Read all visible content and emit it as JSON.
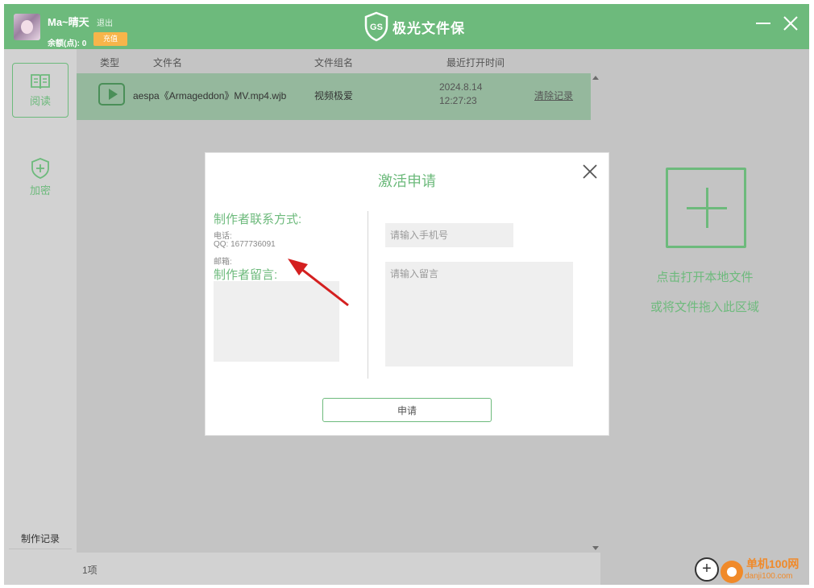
{
  "header": {
    "username": "Ma~晴天",
    "logout_label": "退出",
    "balance": "余额(点): 0",
    "recharge_label": "充值",
    "brand_badge": "GS",
    "brand_name": "极光文件保"
  },
  "sidebar": {
    "items": [
      {
        "label": "阅读",
        "icon": "book-icon"
      },
      {
        "label": "加密",
        "icon": "shield-plus-icon"
      }
    ],
    "record_label": "制作记录"
  },
  "file_list": {
    "columns": [
      "类型",
      "文件名",
      "文件组名",
      "最近打开时间"
    ],
    "rows": [
      {
        "type_icon": "play-icon",
        "name": "aespa《Armageddon》MV.mp4.wjb",
        "group": "视频极爱",
        "date": "2024.8.14",
        "time": "12:27:23",
        "action": "清除记录"
      }
    ],
    "count_label": "1项"
  },
  "right_pane": {
    "open_label": "点击打开本地文件",
    "drag_label": "或将文件拖入此区域"
  },
  "modal": {
    "title": "激活申请",
    "contact_heading": "制作者联系方式:",
    "phone_label": "电话:",
    "qq_label": "QQ: 1677736091",
    "email_label": "邮箱:",
    "message_heading": "制作者留言:",
    "phone_placeholder": "请输入手机号",
    "message_placeholder": "请输入留言",
    "submit_label": "申请"
  },
  "watermark": {
    "title": "单机100网",
    "url": "danji100.com"
  },
  "colors": {
    "accent": "#6dba7c",
    "selected_row": "#95b89d",
    "overlay_gray": "#c4c4c4",
    "annotation_arrow": "#d42020",
    "recharge": "#f7b54a"
  }
}
